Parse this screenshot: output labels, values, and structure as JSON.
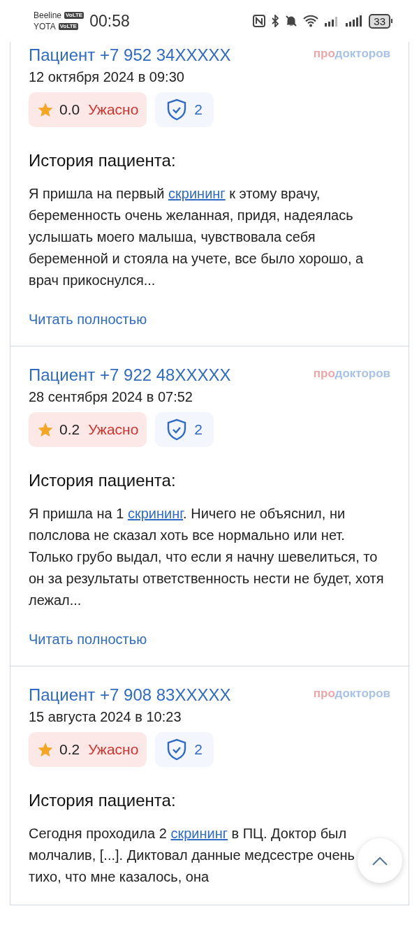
{
  "status_bar": {
    "carriers": [
      {
        "name": "Beeline",
        "badge": "VoLTE"
      },
      {
        "name": "YOTA",
        "badge": "VoLTE"
      }
    ],
    "time": "00:58",
    "battery": "33"
  },
  "reviews": [
    {
      "author": "Пациент +7 952 34XXXXX",
      "source": [
        "про",
        "докторов"
      ],
      "date": "12 октября 2024 в 09:30",
      "rating": "0.0",
      "verdict": "Ужасно",
      "verified": "2",
      "heading": "История пациента:",
      "text_before": "Я пришла на первый ",
      "link": "скрининг",
      "text_after": " к этому врачу, беременность очень желанная, придя, надеялась услышать моего малыша, чувствовала себя беременной и стояла на учете, все было хорошо, а врач прикоснулся...",
      "read_more": "Читать полностью"
    },
    {
      "author": "Пациент +7 922 48XXXXX",
      "source": [
        "про",
        "докторов"
      ],
      "date": "28 сентября 2024 в 07:52",
      "rating": "0.2",
      "verdict": "Ужасно",
      "verified": "2",
      "heading": "История пациента:",
      "text_before": "Я пришла на 1 ",
      "link": "скрининг",
      "text_after": ". Ничего не объяснил, ни полслова не сказал хоть все нормально или нет. Только грубо выдал, что если я начну шевелиться, то он за результаты ответственность нести не будет, хотя лежал...",
      "read_more": "Читать полностью"
    },
    {
      "author": "Пациент +7 908 83XXXXX",
      "source": [
        "про",
        "докторов"
      ],
      "date": "15 августа 2024 в 10:23",
      "rating": "0.2",
      "verdict": "Ужасно",
      "verified": "2",
      "heading": "История пациента:",
      "text_before": "Сегодня проходила 2 ",
      "link": "скрининг",
      "text_after": " в ПЦ. Доктор был молчалив, [...]. Диктовал данные медсестре очень тихо, что мне казалось, она"
    }
  ]
}
